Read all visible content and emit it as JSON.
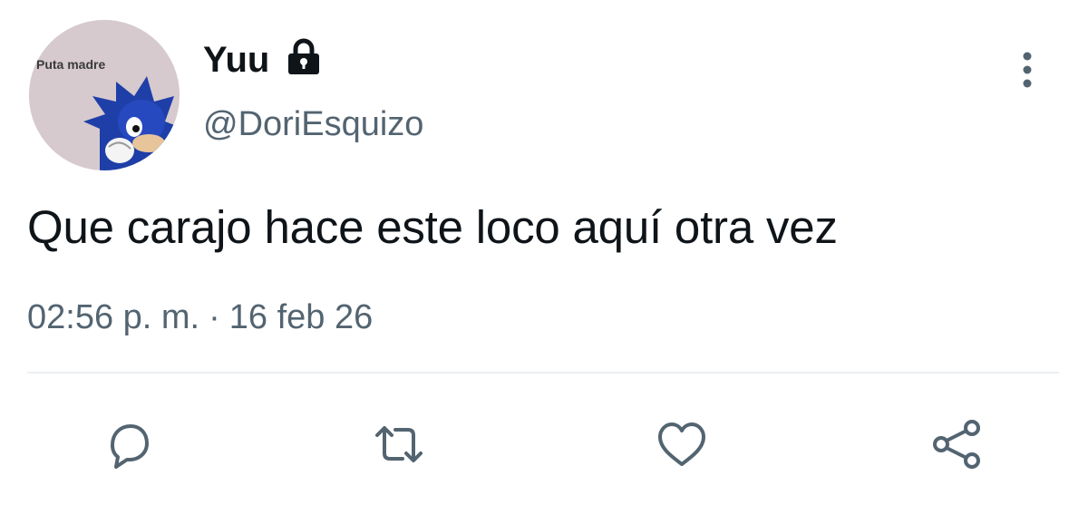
{
  "user": {
    "display_name": "Yuu",
    "handle": "@DoriEsquizo",
    "protected_icon": "lock-icon",
    "avatar_caption": "Puta madre"
  },
  "tweet": {
    "text": "Que carajo hace este loco aquí otra vez",
    "time": "02:56 p. m.",
    "separator": "·",
    "date": "16 feb 26"
  },
  "actions": [
    "reply-icon",
    "retweet-icon",
    "like-icon",
    "share-icon"
  ],
  "colors": {
    "text": "#0f1419",
    "secondary": "#536471",
    "divider": "#eceff1",
    "avatar_bg": "#d6cace"
  }
}
